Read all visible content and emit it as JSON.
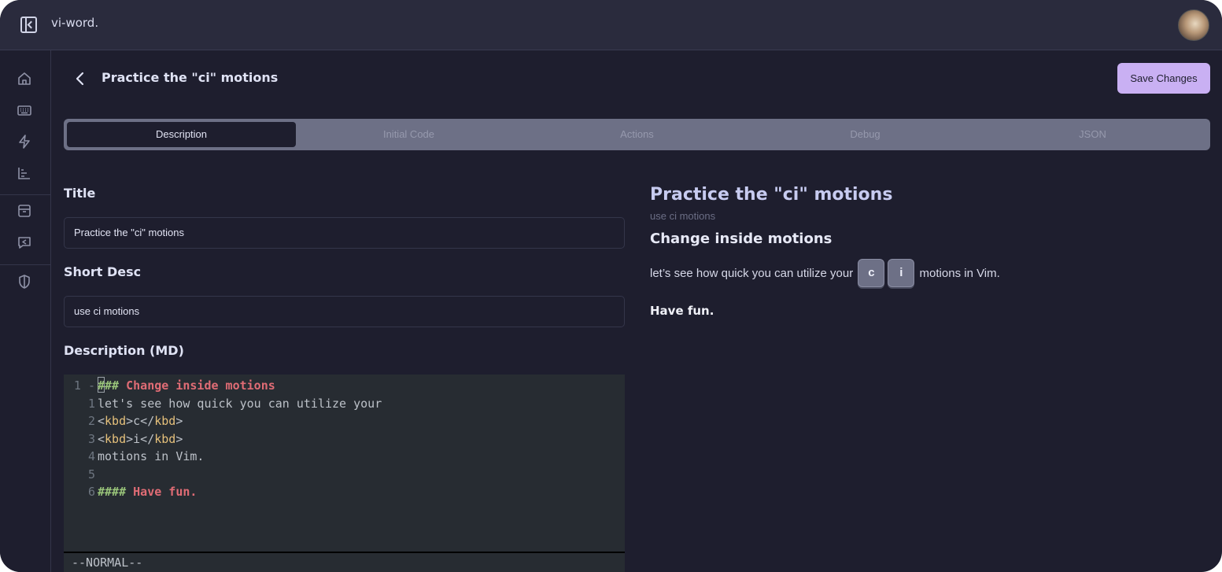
{
  "app": {
    "name": "vi-word."
  },
  "page": {
    "title": "Practice the \"ci\" motions",
    "save_label": "Save Changes"
  },
  "tabs": [
    {
      "label": "Description",
      "active": true
    },
    {
      "label": "Initial Code",
      "active": false
    },
    {
      "label": "Actions",
      "active": false
    },
    {
      "label": "Debug",
      "active": false
    },
    {
      "label": "JSON",
      "active": false
    }
  ],
  "form": {
    "title_label": "Title",
    "title_value": "Practice the \"ci\" motions",
    "short_desc_label": "Short Desc",
    "short_desc_value": "use ci motions",
    "description_label": "Description (MD)"
  },
  "editor": {
    "lines": [
      {
        "num": "1 -",
        "parts": [
          [
            "hash",
            "###"
          ],
          [
            "head",
            " Change inside motions"
          ]
        ]
      },
      {
        "num": "1",
        "parts": [
          [
            "text",
            "let's see how quick you can utilize your"
          ]
        ]
      },
      {
        "num": "2",
        "parts": [
          [
            "text",
            "<"
          ],
          [
            "tag",
            "kbd"
          ],
          [
            "text",
            ">c</"
          ],
          [
            "tag",
            "kbd"
          ],
          [
            "text",
            ">"
          ]
        ]
      },
      {
        "num": "3",
        "parts": [
          [
            "text",
            "<"
          ],
          [
            "tag",
            "kbd"
          ],
          [
            "text",
            ">i</"
          ],
          [
            "tag",
            "kbd"
          ],
          [
            "text",
            ">"
          ]
        ]
      },
      {
        "num": "4",
        "parts": [
          [
            "text",
            "motions in Vim."
          ]
        ]
      },
      {
        "num": "5",
        "parts": []
      },
      {
        "num": "6",
        "parts": [
          [
            "hash",
            "####"
          ],
          [
            "head",
            " Have fun."
          ]
        ]
      }
    ],
    "mode": "--NORMAL--"
  },
  "preview": {
    "title": "Practice the \"ci\" motions",
    "subtitle": "use ci motions",
    "heading": "Change inside motions",
    "para_before": "let’s see how quick you can utilize your ",
    "kbd1": "c",
    "kbd2": "i",
    "para_after": " motions in Vim.",
    "closing": "Have fun."
  },
  "colors": {
    "background": "#1e1e2e",
    "accent": "#c9b0f3",
    "tabbar": "#6d7086",
    "heading_red": "#e06c75",
    "hash_green": "#98c379",
    "tag_yellow": "#e5c07b"
  },
  "icons": {
    "sidebar_toggle": "sidebar-toggle-icon",
    "sidebar": [
      "home-icon",
      "keyboard-icon",
      "lightning-icon",
      "chart-icon",
      "inbox-icon",
      "message-reply-icon",
      "shield-icon"
    ],
    "back": "chevron-left-icon"
  }
}
